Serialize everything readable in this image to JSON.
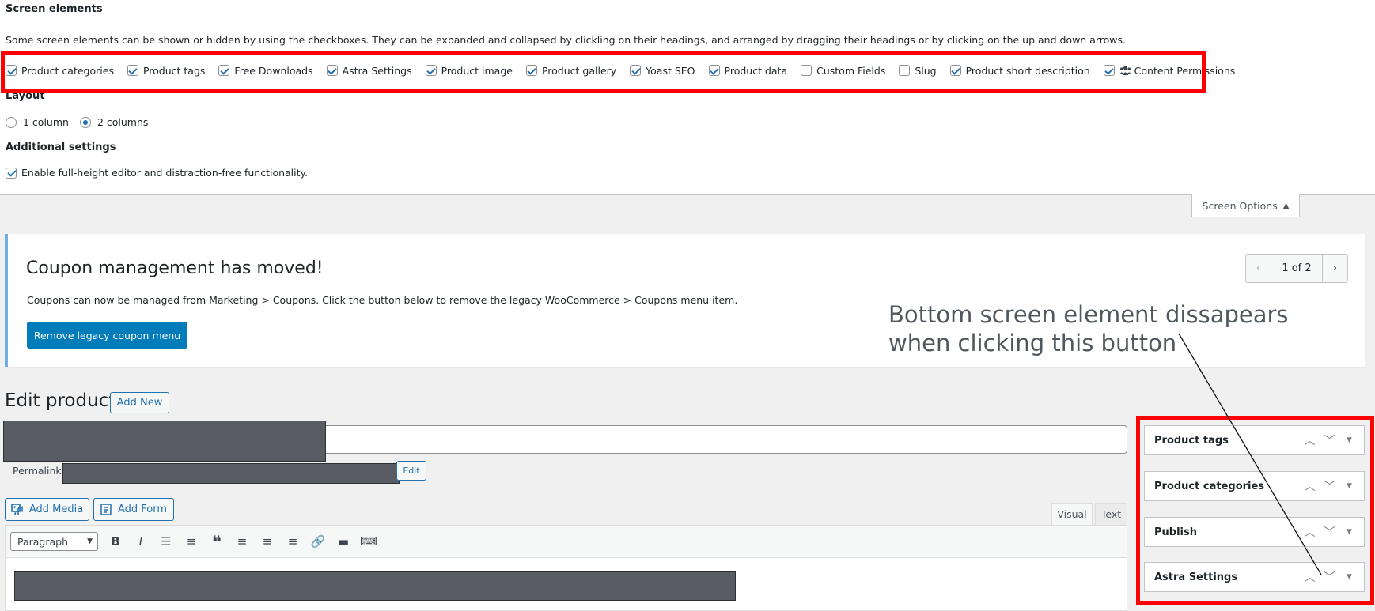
{
  "screen_options": {
    "screen_elements_heading": "Screen elements",
    "description": "Some screen elements can be shown or hidden by using the checkboxes. They can be expanded and collapsed by clickling on their headings, and arranged by dragging their headings or by clicking on the up and down arrows.",
    "checkboxes": [
      {
        "label": "Product categories",
        "checked": true
      },
      {
        "label": "Product tags",
        "checked": true
      },
      {
        "label": "Free Downloads",
        "checked": true
      },
      {
        "label": "Astra Settings",
        "checked": true
      },
      {
        "label": "Product image",
        "checked": true
      },
      {
        "label": "Product gallery",
        "checked": true
      },
      {
        "label": "Yoast SEO",
        "checked": true
      },
      {
        "label": "Product data",
        "checked": true
      },
      {
        "label": "Custom Fields",
        "checked": false
      },
      {
        "label": "Slug",
        "checked": false
      },
      {
        "label": "Product short description",
        "checked": true
      },
      {
        "label": "Content Permissions",
        "checked": true,
        "icon": "users-icon"
      }
    ],
    "layout_heading": "Layout",
    "layout_options": [
      {
        "label": "1 column",
        "checked": false
      },
      {
        "label": "2 columns",
        "checked": true
      }
    ],
    "additional_heading": "Additional settings",
    "additional_checkbox": {
      "label": "Enable full-height editor and distraction-free functionality.",
      "checked": true
    },
    "tab_label": "Screen Options",
    "tab_icon": "arrow-up-icon"
  },
  "notice": {
    "title": "Coupon management has moved!",
    "text": "Coupons can now be managed from Marketing > Coupons. Click the button below to remove the legacy WooCommerce > Coupons menu item.",
    "button_label": "Remove legacy coupon menu",
    "pager_label": "1 of 2"
  },
  "annotation": {
    "line1": "Bottom screen element dissapears",
    "line2": "when clicking this button",
    "color": "#ff0000"
  },
  "editor": {
    "page_title": "Edit product",
    "add_new_label": "Add New",
    "permalink_label": "Permalink:",
    "edit_button_label": "Edit",
    "add_media_label": "Add Media",
    "add_form_label": "Add Form",
    "tab_visual": "Visual",
    "tab_text": "Text",
    "format_select_value": "Paragraph",
    "toolbar_icons": [
      "bold-icon",
      "italic-icon",
      "bullet-list-icon",
      "numbered-list-icon",
      "blockquote-icon",
      "align-left-icon",
      "align-center-icon",
      "align-right-icon",
      "link-icon",
      "read-more-icon",
      "toolbar-toggle-icon"
    ]
  },
  "sidebar": {
    "boxes": [
      {
        "title": "Product tags"
      },
      {
        "title": "Product categories"
      },
      {
        "title": "Publish"
      },
      {
        "title": "Astra Settings"
      }
    ]
  },
  "colors": {
    "accent": "#2271b1",
    "primary_button": "#007cba",
    "notice_border": "#72aee6",
    "redaction": "#595c63"
  }
}
